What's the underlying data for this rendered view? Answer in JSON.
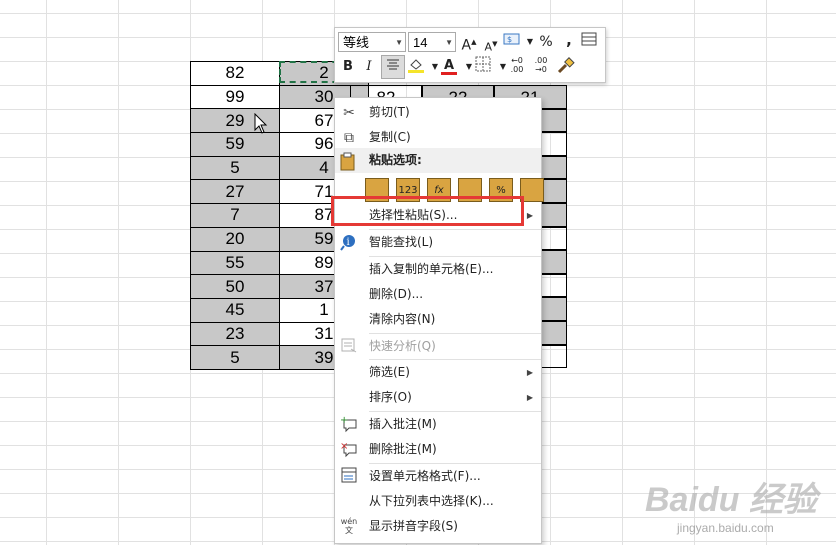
{
  "grid": {
    "rows": [
      {
        "a": "82",
        "b": "2"
      },
      {
        "a": "99",
        "b": "30"
      },
      {
        "a": "29",
        "b": "67"
      },
      {
        "a": "59",
        "b": "96"
      },
      {
        "a": "5",
        "b": "4"
      },
      {
        "a": "27",
        "b": "71"
      },
      {
        "a": "7",
        "b": "87"
      },
      {
        "a": "20",
        "b": "59"
      },
      {
        "a": "55",
        "b": "89"
      },
      {
        "a": "50",
        "b": "37"
      },
      {
        "a": "45",
        "b": "1"
      },
      {
        "a": "23",
        "b": "31"
      },
      {
        "a": "5",
        "b": "39"
      }
    ],
    "partial": {
      "c": "82",
      "d": "22",
      "e": "21"
    }
  },
  "mini_toolbar": {
    "font_name": "等线",
    "font_size": "14",
    "bold": "B",
    "italic": "I",
    "grow_font": "A",
    "shrink_font": "A",
    "percent": "%",
    "comma": ",",
    "font_color_letter": "A",
    "dec_increase": "←0\n.00",
    "dec_decrease": ".00\n→0"
  },
  "context_menu": {
    "cut": "剪切(T)",
    "copy": "复制(C)",
    "paste_options": "粘贴选项:",
    "paste_special": "选择性粘贴(S)...",
    "smart_lookup": "智能查找(L)",
    "insert_copied": "插入复制的单元格(E)...",
    "delete": "删除(D)...",
    "clear": "清除内容(N)",
    "quick_analysis": "快速分析(Q)",
    "filter": "筛选(E)",
    "sort": "排序(O)",
    "insert_comment": "插入批注(M)",
    "delete_comment": "删除批注(M)",
    "format_cells": "设置单元格格式(F)...",
    "pick_list": "从下拉列表中选择(K)...",
    "phonetic": "显示拼音字段(S)",
    "phonetic_icon": "wén"
  },
  "paste_icons": [
    "",
    "123",
    "fx",
    "",
    "%",
    ""
  ],
  "watermark": {
    "brand": "Baidu 经验",
    "url": "jingyan.baidu.com"
  }
}
